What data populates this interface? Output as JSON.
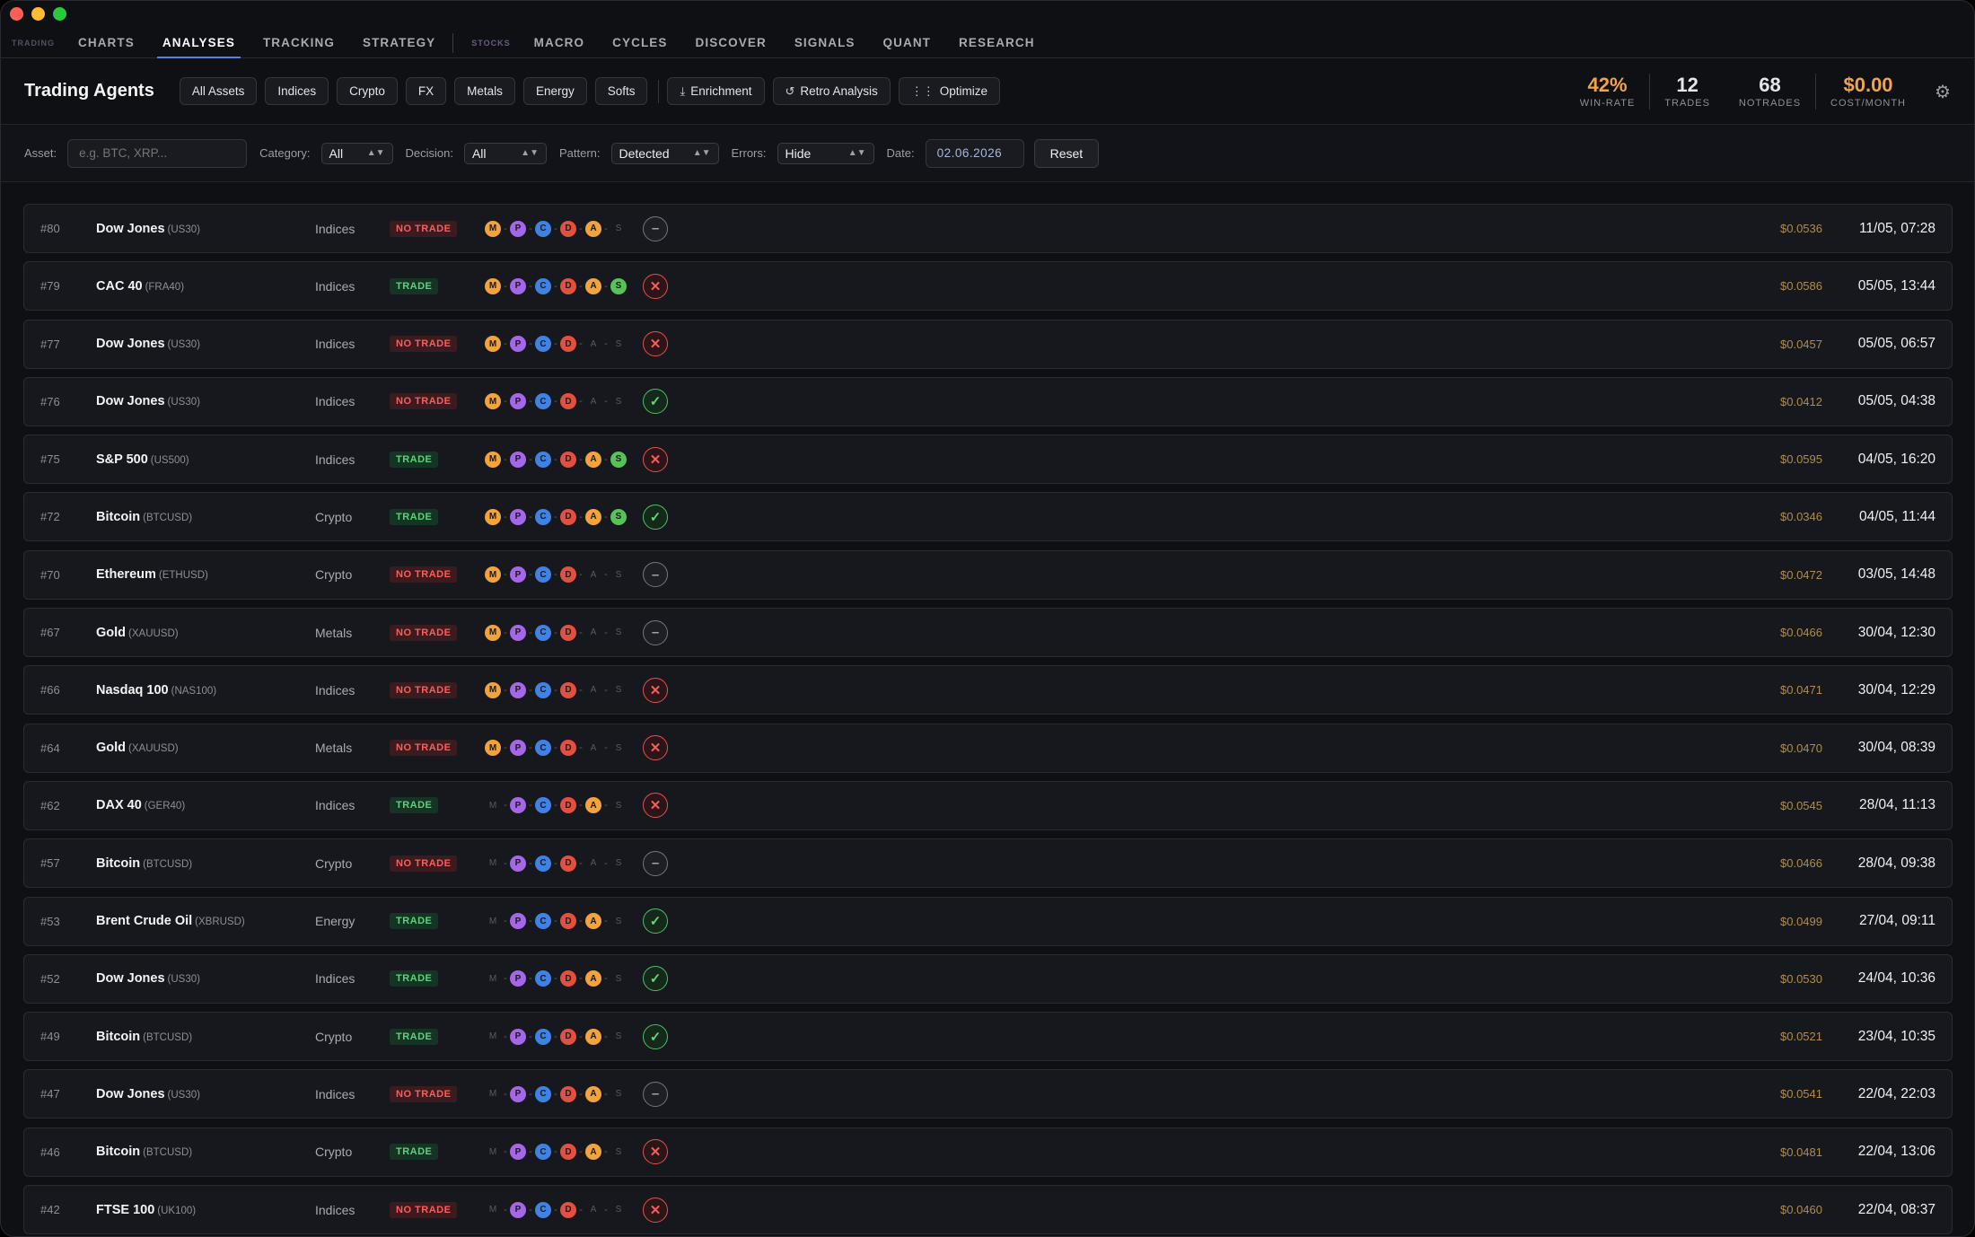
{
  "window_lights": {
    "close": "#ff5f57",
    "minimize": "#febc2e",
    "zoom": "#28c840"
  },
  "nav": {
    "group1": "TRADING",
    "items1": [
      "CHARTS",
      "ANALYSES",
      "TRACKING",
      "STRATEGY"
    ],
    "group2": "STOCKS",
    "items2": [
      "MACRO",
      "CYCLES",
      "DISCOVER",
      "SIGNALS",
      "QUANT",
      "RESEARCH"
    ],
    "active": "ANALYSES"
  },
  "header": {
    "title": "Trading Agents",
    "asset_chips": [
      "All Assets",
      "Indices",
      "Crypto",
      "FX",
      "Metals",
      "Energy",
      "Softs"
    ],
    "actions": [
      {
        "label": "Enrichment",
        "icon": "download-icon"
      },
      {
        "label": "Retro Analysis",
        "icon": "history-icon"
      },
      {
        "label": "Optimize",
        "icon": "sliders-icon"
      }
    ],
    "stats": [
      {
        "value": "42%",
        "label": "WIN-RATE",
        "color": "#f0a44a"
      },
      {
        "value": "12",
        "label": "TRADES",
        "color": "#f2f2f5"
      },
      {
        "value": "68",
        "label": "NOTRADES",
        "color": "#f2f2f5"
      },
      {
        "value": "$0.00",
        "label": "COST/MONTH",
        "color": "#f0a44a"
      }
    ]
  },
  "filters": {
    "asset_label": "Asset:",
    "asset_placeholder": "e.g. BTC, XRP...",
    "category_label": "Category:",
    "category_value": "All",
    "decision_label": "Decision:",
    "decision_value": "All",
    "pattern_label": "Pattern:",
    "pattern_value": "Detected",
    "errors_label": "Errors:",
    "errors_value": "Hide",
    "date_label": "Date:",
    "date_value": "02.06.2026",
    "reset_label": "Reset"
  },
  "agent_colors": {
    "M": "#f3a33b",
    "P": "#a566e8",
    "C": "#3f82e6",
    "D": "#e2513f",
    "A": "#f3a33b",
    "S": "#57c257"
  },
  "rows": [
    {
      "id": "#80",
      "name": "Dow Jones",
      "ticker": "(US30)",
      "category": "Indices",
      "decision": "NO TRADE",
      "agents": "MPCDA-",
      "outcome": "neutral",
      "cost": "$0.0536",
      "time": "11/05, 07:28"
    },
    {
      "id": "#79",
      "name": "CAC 40",
      "ticker": "(FRA40)",
      "category": "Indices",
      "decision": "TRADE",
      "agents": "MPCDAS",
      "outcome": "loss",
      "cost": "$0.0586",
      "time": "05/05, 13:44"
    },
    {
      "id": "#77",
      "name": "Dow Jones",
      "ticker": "(US30)",
      "category": "Indices",
      "decision": "NO TRADE",
      "agents": "MPCD--",
      "outcome": "loss",
      "cost": "$0.0457",
      "time": "05/05, 06:57"
    },
    {
      "id": "#76",
      "name": "Dow Jones",
      "ticker": "(US30)",
      "category": "Indices",
      "decision": "NO TRADE",
      "agents": "MPCD--",
      "outcome": "win",
      "cost": "$0.0412",
      "time": "05/05, 04:38"
    },
    {
      "id": "#75",
      "name": "S&P 500",
      "ticker": "(US500)",
      "category": "Indices",
      "decision": "TRADE",
      "agents": "MPCDAS",
      "outcome": "loss",
      "cost": "$0.0595",
      "time": "04/05, 16:20"
    },
    {
      "id": "#72",
      "name": "Bitcoin",
      "ticker": "(BTCUSD)",
      "category": "Crypto",
      "decision": "TRADE",
      "agents": "MPCDAS",
      "outcome": "win",
      "cost": "$0.0346",
      "time": "04/05, 11:44"
    },
    {
      "id": "#70",
      "name": "Ethereum",
      "ticker": "(ETHUSD)",
      "category": "Crypto",
      "decision": "NO TRADE",
      "agents": "MPCD--",
      "outcome": "neutral",
      "cost": "$0.0472",
      "time": "03/05, 14:48"
    },
    {
      "id": "#67",
      "name": "Gold",
      "ticker": "(XAUUSD)",
      "category": "Metals",
      "decision": "NO TRADE",
      "agents": "MPCD--",
      "outcome": "neutral",
      "cost": "$0.0466",
      "time": "30/04, 12:30"
    },
    {
      "id": "#66",
      "name": "Nasdaq 100",
      "ticker": "(NAS100)",
      "category": "Indices",
      "decision": "NO TRADE",
      "agents": "MPCD--",
      "outcome": "loss",
      "cost": "$0.0471",
      "time": "30/04, 12:29"
    },
    {
      "id": "#64",
      "name": "Gold",
      "ticker": "(XAUUSD)",
      "category": "Metals",
      "decision": "NO TRADE",
      "agents": "MPCD--",
      "outcome": "loss",
      "cost": "$0.0470",
      "time": "30/04, 08:39"
    },
    {
      "id": "#62",
      "name": "DAX 40",
      "ticker": "(GER40)",
      "category": "Indices",
      "decision": "TRADE",
      "agents": "-PCDA-",
      "outcome": "loss",
      "cost": "$0.0545",
      "time": "28/04, 11:13"
    },
    {
      "id": "#57",
      "name": "Bitcoin",
      "ticker": "(BTCUSD)",
      "category": "Crypto",
      "decision": "NO TRADE",
      "agents": "-PCD--",
      "outcome": "neutral",
      "cost": "$0.0466",
      "time": "28/04, 09:38"
    },
    {
      "id": "#53",
      "name": "Brent Crude Oil",
      "ticker": "(XBRUSD)",
      "category": "Energy",
      "decision": "TRADE",
      "agents": "-PCDA-",
      "outcome": "win",
      "cost": "$0.0499",
      "time": "27/04, 09:11"
    },
    {
      "id": "#52",
      "name": "Dow Jones",
      "ticker": "(US30)",
      "category": "Indices",
      "decision": "TRADE",
      "agents": "-PCDA-",
      "outcome": "win",
      "cost": "$0.0530",
      "time": "24/04, 10:36"
    },
    {
      "id": "#49",
      "name": "Bitcoin",
      "ticker": "(BTCUSD)",
      "category": "Crypto",
      "decision": "TRADE",
      "agents": "-PCDA-",
      "outcome": "win",
      "cost": "$0.0521",
      "time": "23/04, 10:35"
    },
    {
      "id": "#47",
      "name": "Dow Jones",
      "ticker": "(US30)",
      "category": "Indices",
      "decision": "NO TRADE",
      "agents": "-PCDA-",
      "outcome": "neutral",
      "cost": "$0.0541",
      "time": "22/04, 22:03"
    },
    {
      "id": "#46",
      "name": "Bitcoin",
      "ticker": "(BTCUSD)",
      "category": "Crypto",
      "decision": "TRADE",
      "agents": "-PCDA-",
      "outcome": "loss",
      "cost": "$0.0481",
      "time": "22/04, 13:06"
    },
    {
      "id": "#42",
      "name": "FTSE 100",
      "ticker": "(UK100)",
      "category": "Indices",
      "decision": "NO TRADE",
      "agents": "-PCD--",
      "outcome": "loss",
      "cost": "$0.0460",
      "time": "22/04, 08:37"
    }
  ]
}
